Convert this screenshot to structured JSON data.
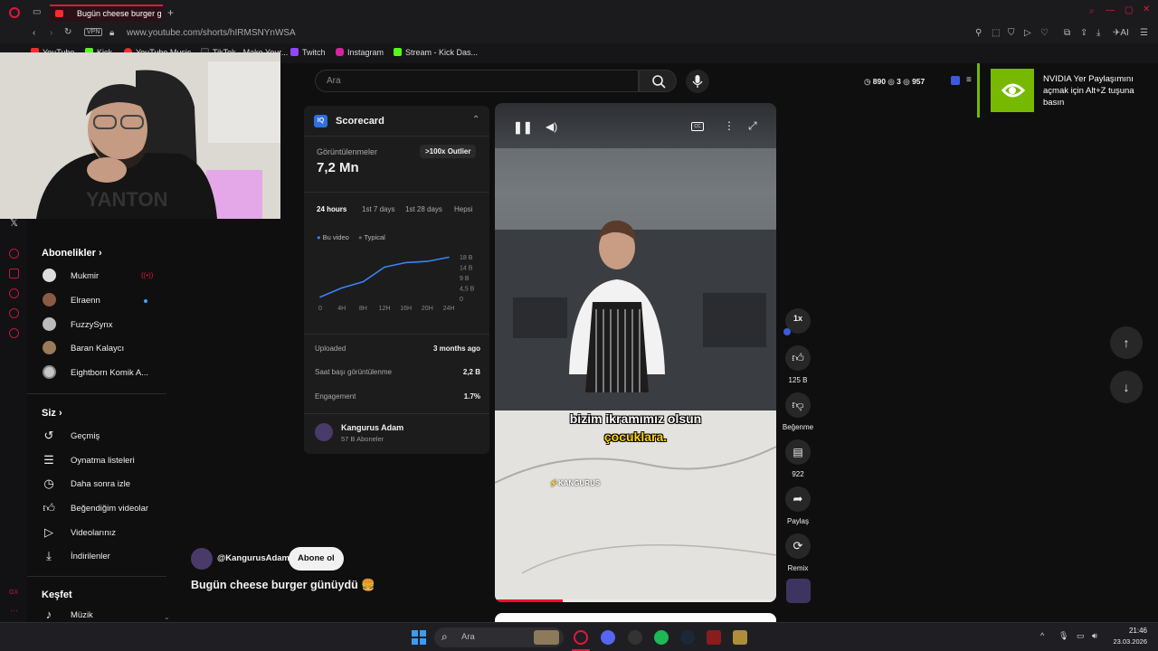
{
  "browser": {
    "tab_title": "Bugün cheese burger g",
    "new_tab": "+",
    "vpn": "VPN",
    "url": "www.youtube.com/shorts/hIRMSNYnWSA",
    "ai_label": "AI",
    "bookmarks": [
      "YouTube",
      "Kick",
      "YouTube Music",
      "TikTok - Make Your...",
      "Twitch",
      "Instagram",
      "Stream - Kick Das..."
    ]
  },
  "stream_stats": {
    "viewers": "890",
    "b": "3",
    "c": "957"
  },
  "nvidia_toast": "NVIDIA Yer Paylaşımını açmak için Alt+Z tuşuna basın",
  "sidebar": {
    "subs_header": "Abonelikler",
    "subs": [
      "Mukmir",
      "Elraenn",
      "FuzzySynx",
      "Baran Kalaycı",
      "Eightborn Komik A..."
    ],
    "you_header": "Siz",
    "you_items": [
      "Geçmiş",
      "Oynatma listeleri",
      "Daha sonra izle",
      "Beğendiğim videolar",
      "Videolarınız",
      "İndirilenler"
    ],
    "explore_header": "Keşfet",
    "explore_items": [
      "Müzik"
    ]
  },
  "search": {
    "placeholder": "Ara"
  },
  "scorecard": {
    "title": "Scorecard",
    "views_label": "Görüntülenmeler",
    "views_value": "7,2 Mn",
    "outlier_badge": ">100x Outlier",
    "tabs": [
      "24 hours",
      "1st 7 days",
      "1st 28 days",
      "Hepsi"
    ],
    "legend": [
      "Bu video",
      "Typical"
    ],
    "uploaded_label": "Uploaded",
    "uploaded_value": "3 months ago",
    "hourly_label": "Saat başı görüntülenme",
    "hourly_value": "2,2 B",
    "engagement_label": "Engagement",
    "engagement_value": "1.7%",
    "channel_name": "Kangurus Adam",
    "channel_subs": "57 B Aboneler"
  },
  "chart_data": {
    "type": "line",
    "x": [
      "0",
      "4H",
      "8H",
      "12H",
      "16H",
      "20H",
      "24H"
    ],
    "series": [
      {
        "name": "Bu video",
        "values": [
          0.6,
          4.5,
          7.2,
          13.5,
          15.5,
          16.0,
          17.8
        ]
      }
    ],
    "y_ticks": [
      "18 B",
      "14 B",
      "9 B",
      "4,5 B",
      "0"
    ],
    "ylim": [
      0,
      18
    ],
    "legend_position": "top-left"
  },
  "video": {
    "caption_line1": "bizim ikramımız olsun",
    "caption_line2": "çocuklara.",
    "watermark": "KANGURUS",
    "progress": 0.24
  },
  "actions": {
    "speed": "1x",
    "likes": "125 B",
    "dislike": "Beğenme",
    "comments": "922",
    "share": "Paylaş",
    "remix": "Remix"
  },
  "channel_row": {
    "handle": "@KangurusAdam",
    "subscribe": "Abone ol"
  },
  "video_title": "Bugün cheese burger günüydü 🍔",
  "taskbar": {
    "search": "Ara",
    "time": "21:46",
    "date": "23.03.2026"
  },
  "colors": {
    "accent": "#e0183c",
    "nvidia": "#76b900",
    "chart_line": "#3b82f6"
  }
}
